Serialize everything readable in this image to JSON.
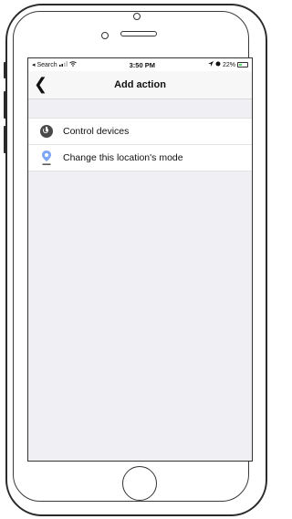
{
  "status_bar": {
    "back_app": "◂ Search",
    "time": "3:50 PM",
    "battery": "22%"
  },
  "nav": {
    "back_icon": "chevron-left-icon",
    "title": "Add action"
  },
  "actions": [
    {
      "label": "Control devices",
      "icon": "power-icon"
    },
    {
      "label": "Change this location's mode",
      "icon": "location-pin-icon"
    }
  ],
  "colors": {
    "screen_bg": "#efeff4",
    "row_bg": "#ffffff",
    "pin": "#7ea6f5"
  }
}
